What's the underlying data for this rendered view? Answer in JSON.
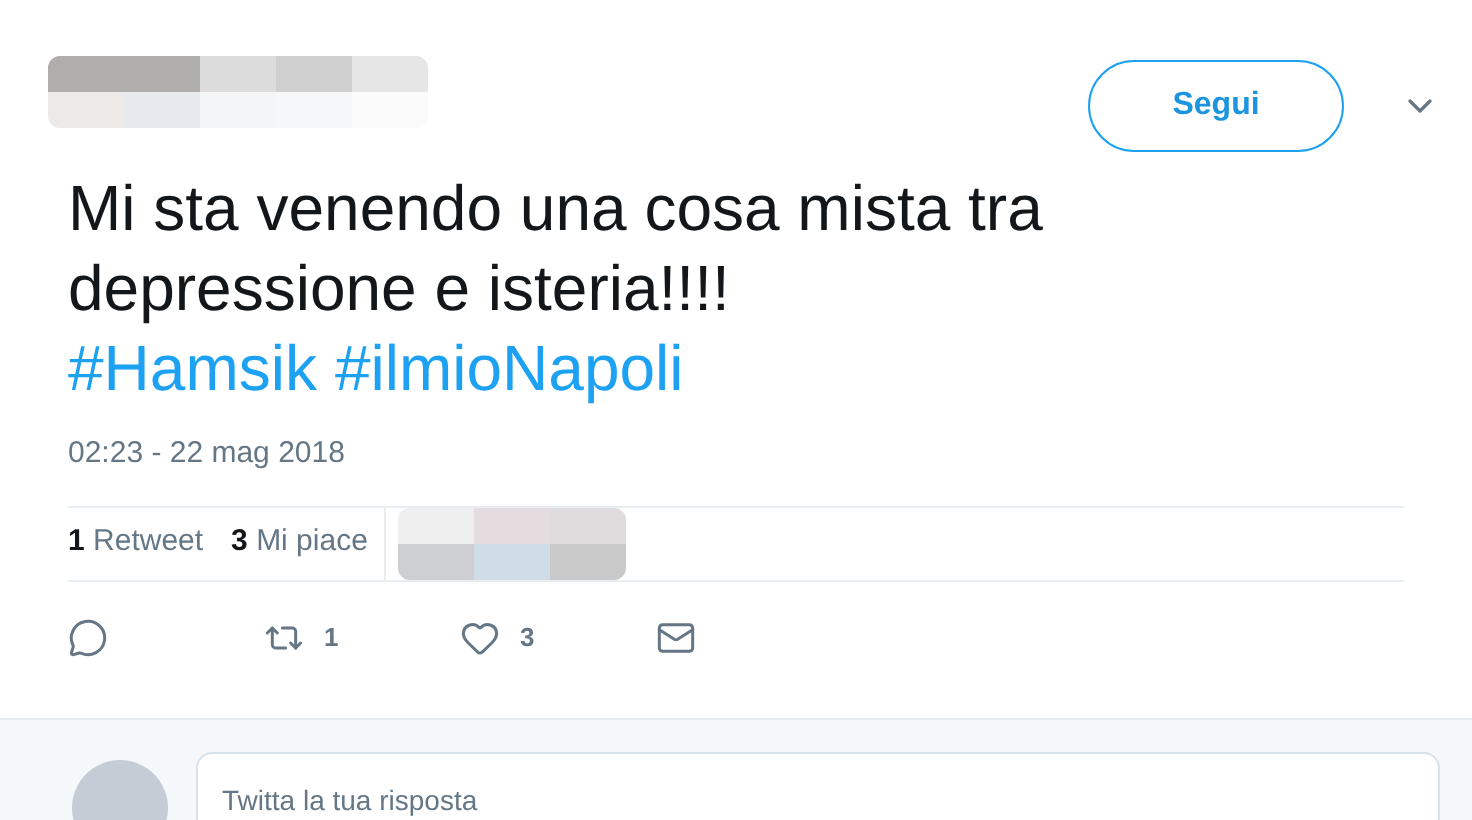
{
  "follow_button": "Segui",
  "tweet": [
    {
      "kind": "text",
      "text": "Mi sta venendo una cosa mista tra depressione e isteria!!!! "
    },
    {
      "kind": "hashtag",
      "text": "#Hamsik"
    },
    {
      "kind": "hashtag",
      "text": "#ilmioNapoli"
    }
  ],
  "timestamp": "02:23 - 22 mag 2018",
  "stats": [
    {
      "count": "1",
      "label": "Retweet"
    },
    {
      "count": "3",
      "label": "Mi piace"
    }
  ],
  "actions": [
    {
      "kind": "reply"
    },
    {
      "kind": "retweet",
      "count": "1"
    },
    {
      "kind": "like",
      "count": "3"
    },
    {
      "kind": "message"
    }
  ],
  "reply_field": {
    "placeholder": "Twitta la tua risposta"
  }
}
